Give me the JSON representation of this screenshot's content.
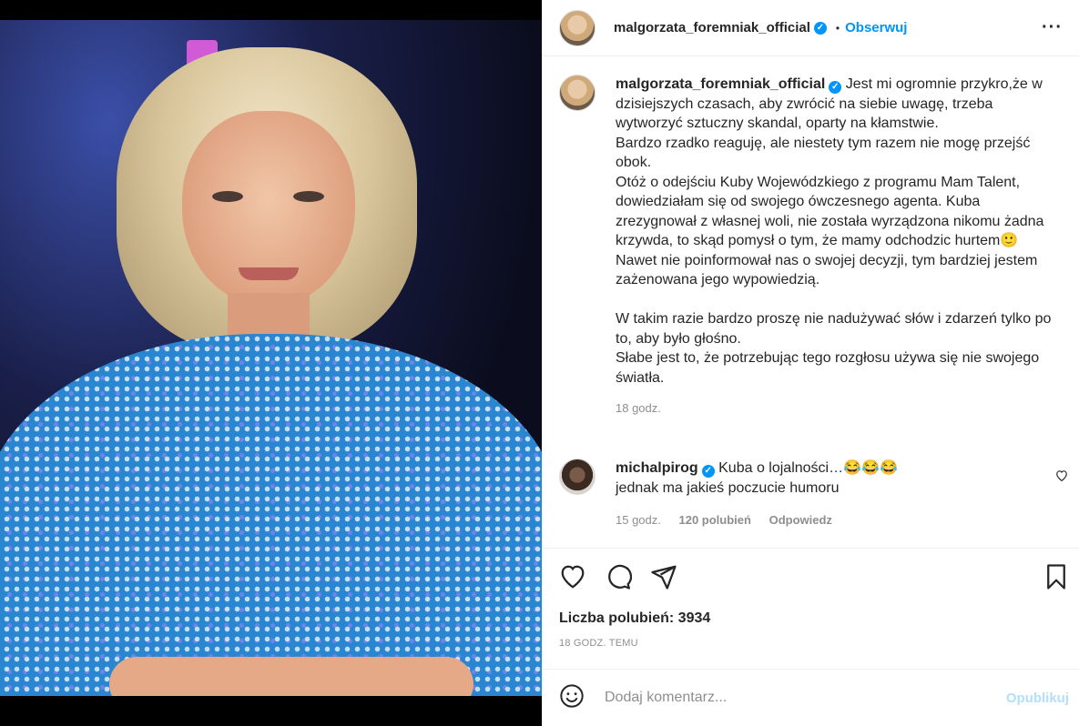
{
  "colors": {
    "accent": "#0095f6",
    "muted": "#8e8e8e",
    "text": "#262626",
    "post_disabled": "#b2dffc"
  },
  "header": {
    "username": "malgorzata_foremniak_official",
    "verified_icon": "verified-badge-icon",
    "separator": "•",
    "follow_label": "Obserwuj",
    "more_icon": "more-options-icon",
    "more_glyph": "···"
  },
  "caption": {
    "username": "malgorzata_foremniak_official",
    "text": " Jest mi ogromnie przykro,że w dzisiejszych czasach, aby zwrócić na siebie uwagę, trzeba wytworzyć sztuczny skandal, oparty na kłamstwie.\nBardzo rzadko reaguję, ale niestety tym razem nie mogę przejść obok.\nOtóż o odejściu Kuby Wojewódzkiego z programu Mam Talent, dowiedziałam się od swojego ówczesnego agenta. Kuba zrezygnował z własnej woli, nie została wyrządzona nikomu żadna krzywda, to skąd pomysł o tym, że mamy odchodzic hurtem🙂\nNawet nie poinformował nas o swojej decyzji, tym bardziej jestem zażenowana jego wypowiedzią.\n\nW takim razie bardzo proszę nie nadużywać słów i zdarzeń tylko po to, aby było głośno.\nSłabe jest to, że potrzebując tego rozgłosu używa się nie swojego światła.",
    "time": "18 godz."
  },
  "comment": {
    "username": "michalpirog",
    "text": " Kuba o lojalności…😂😂😂\njednak ma jakieś poczucie humoru",
    "time": "15 godz.",
    "likes": "120 polubień",
    "reply_label": "Odpowiedz",
    "like_icon": "heart-small-icon"
  },
  "actions": {
    "like_icon": "heart-icon",
    "comment_icon": "comment-icon",
    "share_icon": "share-icon",
    "save_icon": "bookmark-icon",
    "likes_text": "Liczba polubień: 3934",
    "posted_ago": "18 GODZ. TEMU"
  },
  "add_comment": {
    "emoji_icon": "emoji-icon",
    "placeholder": "Dodaj komentarz...",
    "post_label": "Opublikuj"
  }
}
